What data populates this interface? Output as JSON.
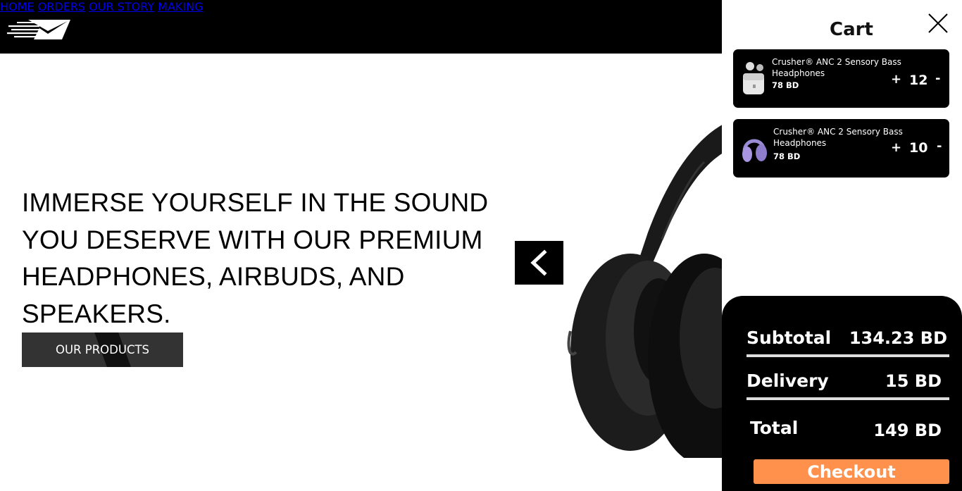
{
  "nav": {
    "home": "HOME",
    "orders": "ORDERS",
    "our_story": "OUR STORY",
    "making": "MAKING"
  },
  "hero": {
    "headline": "IMMERSE YOURSELF IN THE SOUND YOU DESERVE WITH OUR PREMIUM HEADPHONES, AIRBUDS, AND SPEAKERS.",
    "cta_label": "OUR PRODUCTS"
  },
  "cart": {
    "title": "Cart",
    "items": [
      {
        "name": "Crusher® ANC 2 Sensory Bass Headphones",
        "price": "78 BD",
        "quantity": "12",
        "plus": "+",
        "minus": "-",
        "icon": "white-earbuds-icon"
      },
      {
        "name": "Crusher® ANC 2 Sensory Bass Headphones",
        "price": "78 BD",
        "quantity": "10",
        "plus": "+",
        "minus": "-",
        "icon": "purple-headphones-icon"
      }
    ],
    "subtotal_label": "Subtotal",
    "subtotal_value": "134.23 BD",
    "delivery_label": "Delivery",
    "delivery_value": "15 BD",
    "total_label": "Total",
    "total_value": "149 BD",
    "checkout_label": "Checkout"
  },
  "colors": {
    "header_bg": "#000000",
    "checkout_accent": "#ff914d",
    "item_card_bg": "#000000"
  }
}
